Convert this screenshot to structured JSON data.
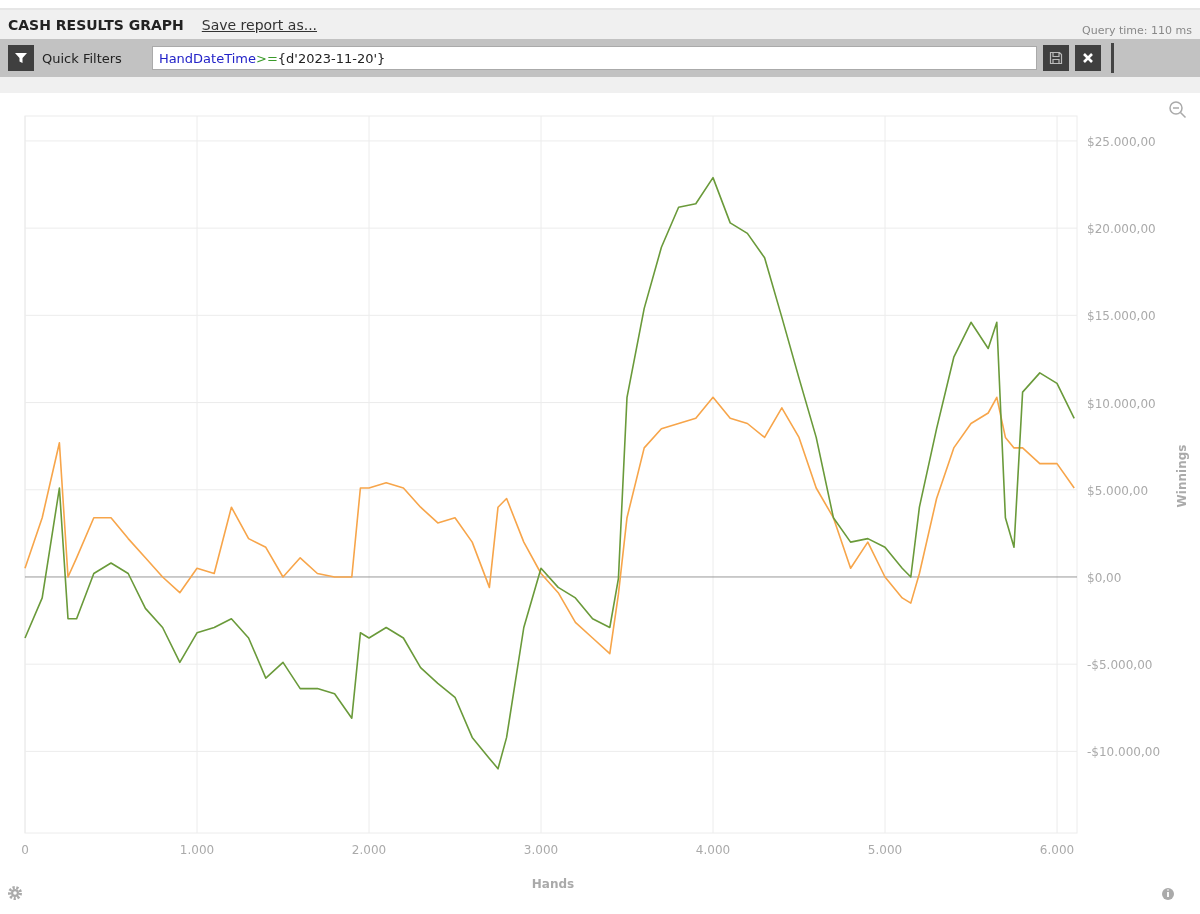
{
  "header": {
    "title": "CASH RESULTS GRAPH",
    "save_link": "Save report as...",
    "query_time": "Query time: 110 ms"
  },
  "filter_bar": {
    "label": "Quick Filters",
    "query_tokens": [
      {
        "text": "HandDateTime",
        "kind": "field"
      },
      {
        "text": ">=",
        "kind": "operator"
      },
      {
        "text": "{d'2023-11-20'}",
        "kind": "literal"
      }
    ]
  },
  "chart": {
    "chart_data": {
      "type": "line",
      "grid": true,
      "xlabel": "Hands",
      "ylabel": "Winnings",
      "x": [
        0,
        100,
        200,
        250,
        300,
        400,
        500,
        600,
        700,
        800,
        900,
        1000,
        1100,
        1200,
        1300,
        1400,
        1500,
        1600,
        1700,
        1800,
        1900,
        1950,
        2000,
        2100,
        2200,
        2300,
        2400,
        2500,
        2600,
        2700,
        2750,
        2800,
        2900,
        3000,
        3100,
        3200,
        3300,
        3400,
        3450,
        3500,
        3600,
        3700,
        3800,
        3900,
        4000,
        4100,
        4200,
        4300,
        4400,
        4500,
        4600,
        4700,
        4800,
        4900,
        5000,
        5100,
        5150,
        5200,
        5300,
        5400,
        5500,
        5600,
        5650,
        5700,
        5750,
        5800,
        5900,
        6000,
        6100
      ],
      "series": [
        {
          "color": "#f7a54a",
          "values": [
            500,
            3400,
            7700,
            0,
            1100,
            3400,
            3400,
            2200,
            1100,
            0,
            -900,
            500,
            200,
            4000,
            2200,
            1700,
            0,
            1100,
            200,
            0,
            0,
            5100,
            5100,
            5400,
            5100,
            4000,
            3100,
            3400,
            2000,
            -600,
            4000,
            4500,
            2000,
            200,
            -900,
            -2600,
            -3500,
            -4400,
            -1000,
            3400,
            7400,
            8500,
            8800,
            9100,
            10300,
            9100,
            8800,
            8000,
            9700,
            8000,
            5100,
            3400,
            500,
            2000,
            0,
            -1200,
            -1500,
            200,
            4500,
            7400,
            8800,
            9400,
            10300,
            8000,
            7400,
            7400,
            6500,
            6500,
            5100
          ]
        },
        {
          "color": "#6a9a3a",
          "values": [
            -3500,
            -1200,
            5100,
            -2400,
            -2400,
            200,
            800,
            200,
            -1800,
            -2900,
            -4900,
            -3200,
            -2900,
            -2400,
            -3500,
            -5800,
            -4900,
            -6400,
            -6400,
            -6700,
            -8100,
            -3200,
            -3500,
            -2900,
            -3500,
            -5200,
            -6100,
            -6900,
            -9200,
            -10400,
            -11000,
            -9200,
            -2900,
            500,
            -600,
            -1200,
            -2400,
            -2900,
            -100,
            10300,
            15400,
            18900,
            21200,
            21400,
            22900,
            20300,
            19700,
            18300,
            14900,
            11400,
            8000,
            3400,
            2000,
            2200,
            1700,
            500,
            0,
            4000,
            8500,
            12600,
            14600,
            13100,
            14600,
            3400,
            1700,
            10600,
            11700,
            11100,
            9100
          ]
        }
      ],
      "xlim": [
        0,
        6116
      ],
      "ylim": [
        -14680,
        26430
      ],
      "xticks": [
        {
          "value": 0,
          "label": "0"
        },
        {
          "value": 1000,
          "label": "1.000"
        },
        {
          "value": 2000,
          "label": "2.000"
        },
        {
          "value": 3000,
          "label": "3.000"
        },
        {
          "value": 4000,
          "label": "4.000"
        },
        {
          "value": 5000,
          "label": "5.000"
        },
        {
          "value": 6000,
          "label": "6.000"
        }
      ],
      "yticks": [
        {
          "value": -10000,
          "label": "-$10.000,00"
        },
        {
          "value": -5000,
          "label": "-$5.000,00"
        },
        {
          "value": 0,
          "label": "$0,00"
        },
        {
          "value": 5000,
          "label": "$5.000,00"
        },
        {
          "value": 10000,
          "label": "$10.000,00"
        },
        {
          "value": 15000,
          "label": "$15.000,00"
        },
        {
          "value": 20000,
          "label": "$20.000,00"
        },
        {
          "value": 25000,
          "label": "$25.000,00"
        }
      ]
    }
  }
}
